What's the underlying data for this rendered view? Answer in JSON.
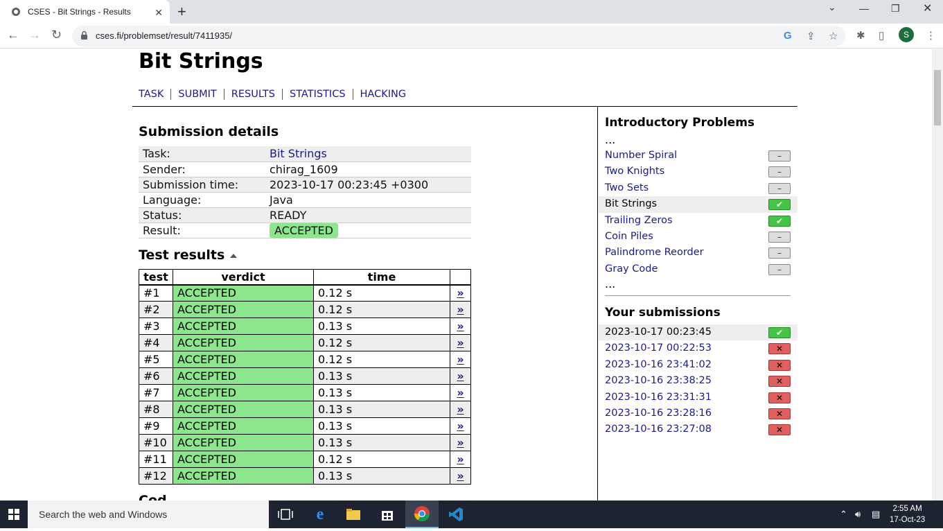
{
  "browser": {
    "tab_title": "CSES - Bit Strings - Results",
    "url": "cses.fi/problemset/result/7411935/",
    "profile_initial": "S"
  },
  "page": {
    "title": "Bit Strings",
    "nav": [
      "TASK",
      "SUBMIT",
      "RESULTS",
      "STATISTICS",
      "HACKING"
    ]
  },
  "submission": {
    "heading": "Submission details",
    "rows": [
      {
        "key": "Task:",
        "value": "Bit Strings"
      },
      {
        "key": "Sender:",
        "value": "chirag_1609"
      },
      {
        "key": "Submission time:",
        "value": "2023-10-17 00:23:45 +0300"
      },
      {
        "key": "Language:",
        "value": "Java"
      },
      {
        "key": "Status:",
        "value": "READY"
      },
      {
        "key": "Result:",
        "value": "ACCEPTED"
      }
    ]
  },
  "tests": {
    "heading": "Test results",
    "columns": [
      "test",
      "verdict",
      "time"
    ],
    "link_glyph": "»",
    "rows": [
      {
        "test": "#1",
        "verdict": "ACCEPTED",
        "time": "0.12 s"
      },
      {
        "test": "#2",
        "verdict": "ACCEPTED",
        "time": "0.12 s"
      },
      {
        "test": "#3",
        "verdict": "ACCEPTED",
        "time": "0.13 s"
      },
      {
        "test": "#4",
        "verdict": "ACCEPTED",
        "time": "0.12 s"
      },
      {
        "test": "#5",
        "verdict": "ACCEPTED",
        "time": "0.12 s"
      },
      {
        "test": "#6",
        "verdict": "ACCEPTED",
        "time": "0.13 s"
      },
      {
        "test": "#7",
        "verdict": "ACCEPTED",
        "time": "0.13 s"
      },
      {
        "test": "#8",
        "verdict": "ACCEPTED",
        "time": "0.13 s"
      },
      {
        "test": "#9",
        "verdict": "ACCEPTED",
        "time": "0.13 s"
      },
      {
        "test": "#10",
        "verdict": "ACCEPTED",
        "time": "0.13 s"
      },
      {
        "test": "#11",
        "verdict": "ACCEPTED",
        "time": "0.12 s"
      },
      {
        "test": "#12",
        "verdict": "ACCEPTED",
        "time": "0.13 s"
      }
    ],
    "next_heading_partial": "Cod"
  },
  "sidebar": {
    "problems_heading": "Introductory Problems",
    "ellipsis": "...",
    "problems": [
      {
        "name": "Number Spiral",
        "status": "none"
      },
      {
        "name": "Two Knights",
        "status": "none"
      },
      {
        "name": "Two Sets",
        "status": "none"
      },
      {
        "name": "Bit Strings",
        "status": "ok",
        "current": true
      },
      {
        "name": "Trailing Zeros",
        "status": "ok"
      },
      {
        "name": "Coin Piles",
        "status": "none"
      },
      {
        "name": "Palindrome Reorder",
        "status": "none"
      },
      {
        "name": "Gray Code",
        "status": "none"
      }
    ],
    "submissions_heading": "Your submissions",
    "submissions": [
      {
        "time": "2023-10-17 00:23:45",
        "status": "ok",
        "current": true
      },
      {
        "time": "2023-10-17 00:22:53",
        "status": "fail"
      },
      {
        "time": "2023-10-16 23:41:02",
        "status": "fail"
      },
      {
        "time": "2023-10-16 23:38:25",
        "status": "fail"
      },
      {
        "time": "2023-10-16 23:31:31",
        "status": "fail"
      },
      {
        "time": "2023-10-16 23:28:16",
        "status": "fail"
      },
      {
        "time": "2023-10-16 23:27:08",
        "status": "fail"
      }
    ]
  },
  "taskbar": {
    "search_placeholder": "Search the web and Windows",
    "time": "2:55 AM",
    "date": "17-Oct-23"
  },
  "colors": {
    "accepted": "#8ce68c",
    "link": "#1a1a8c",
    "ok_indicator": "#44c544",
    "fail_indicator": "#e06060"
  }
}
